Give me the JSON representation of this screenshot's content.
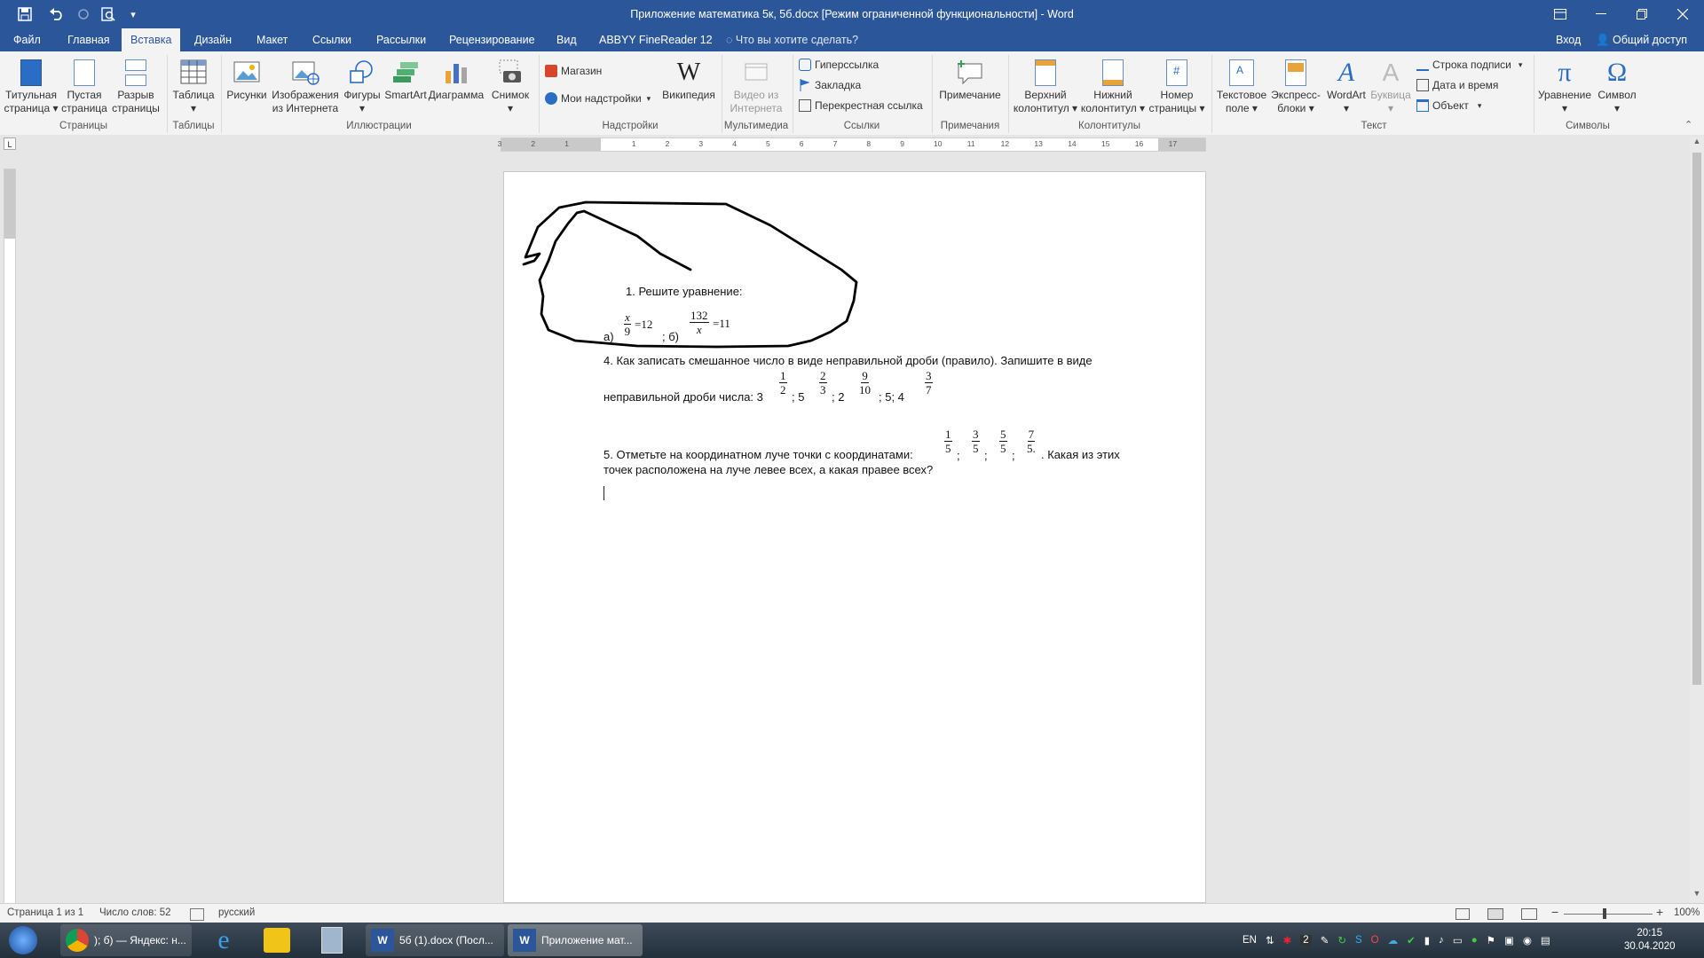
{
  "title_bar": {
    "document_title": "Приложение математика 5к, 5б.docx [Режим ограниченной функциональности] - Word"
  },
  "tabs": [
    "Файл",
    "Главная",
    "Вставка",
    "Дизайн",
    "Макет",
    "Ссылки",
    "Рассылки",
    "Рецензирование",
    "Вид",
    "ABBYY FineReader 12"
  ],
  "active_tab": "Вставка",
  "tell_me": "Что вы хотите сделать?",
  "sign_in": "Вход",
  "share": "Общий доступ",
  "ribbon": {
    "pages": {
      "group": "Страницы",
      "title_page": [
        "Титульная",
        "страница ▾"
      ],
      "blank_page": [
        "Пустая",
        "страница"
      ],
      "page_break": [
        "Разрыв",
        "страницы"
      ]
    },
    "tables": {
      "group": "Таблицы",
      "table": [
        "Таблица",
        "▾"
      ]
    },
    "illustrations": {
      "group": "Иллюстрации",
      "pictures": "Рисунки",
      "online_pictures": [
        "Изображения",
        "из Интернета"
      ],
      "shapes": [
        "Фигуры",
        "▾"
      ],
      "smartart": "SmartArt",
      "chart": "Диаграмма",
      "screenshot": [
        "Снимок",
        "▾"
      ]
    },
    "addins": {
      "group": "Надстройки",
      "store": "Магазин",
      "my_addins": "Мои надстройки",
      "wikipedia": "Википедия"
    },
    "media": {
      "group": "Мультимедиа",
      "online_video": [
        "Видео из",
        "Интернета"
      ]
    },
    "links": {
      "group": "Ссылки",
      "hyperlink": "Гиперссылка",
      "bookmark": "Закладка",
      "cross_reference": "Перекрестная ссылка"
    },
    "comments": {
      "group": "Примечания",
      "comment": "Примечание"
    },
    "header_footer": {
      "group": "Колонтитулы",
      "header": [
        "Верхний",
        "колонтитул ▾"
      ],
      "footer": [
        "Нижний",
        "колонтитул ▾"
      ],
      "page_number": [
        "Номер",
        "страницы ▾"
      ]
    },
    "text": {
      "group": "Текст",
      "text_box": [
        "Текстовое",
        "поле ▾"
      ],
      "quick_parts": [
        "Экспресс-",
        "блоки ▾"
      ],
      "wordart": [
        "WordArt",
        "▾"
      ],
      "drop_cap": [
        "Буквица",
        "▾"
      ],
      "signature_line": "Строка подписи",
      "date_time": "Дата и время",
      "object": "Объект"
    },
    "symbols": {
      "group": "Символы",
      "equation": [
        "Уравнение",
        "▾"
      ],
      "symbol": [
        "Символ",
        "▾"
      ]
    }
  },
  "ruler_numbers": [
    "3",
    "2",
    "1",
    "1",
    "2",
    "3",
    "4",
    "5",
    "6",
    "7",
    "8",
    "9",
    "10",
    "11",
    "12",
    "13",
    "14",
    "15",
    "16",
    "17"
  ],
  "document": {
    "q1": "1.   Решите уравнение:",
    "q1_a": "а)",
    "q1_eq1": {
      "num": "x",
      "den": "9",
      "rhs": "=12"
    },
    "q1_sep": "; б)",
    "q1_eq2": {
      "num": "132",
      "den": "x",
      "rhs": "=11"
    },
    "q4_line1": "4. Как записать смешанное число в виде неправильной дроби (правило). Запишите в виде",
    "q4_line2_prefix": "неправильной дроби числа: 3",
    "q4_fracs": [
      {
        "num": "1",
        "den": "2",
        "after": "; 5"
      },
      {
        "num": "2",
        "den": "3",
        "after": "; 2"
      },
      {
        "num": "9",
        "den": "10",
        "after": "; 5; 4"
      },
      {
        "num": "3",
        "den": "7",
        "after": ""
      }
    ],
    "q5_prefix": "5. Отметьте на координатном луче точки с координатами:",
    "q5_fracs": [
      {
        "num": "1",
        "den": "5",
        "after": ";"
      },
      {
        "num": "3",
        "den": "5",
        "after": ";"
      },
      {
        "num": "5",
        "den": "5",
        "after": ";"
      },
      {
        "num": "7",
        "den": "5.",
        "after": ""
      }
    ],
    "q5_suffix": ". Какая из этих",
    "q5_line2": "точек расположена на луче левее всех, а какая правее всех?"
  },
  "status": {
    "page": "Страница 1 из 1",
    "words": "Число слов: 52",
    "language": "русский",
    "zoom": "100%"
  },
  "taskbar": {
    "items": [
      {
        "label": "); б) — Яндекс: н..."
      },
      {
        "label": "5б (1).docx (Посл..."
      },
      {
        "label": "Приложение мат..."
      }
    ],
    "lang": "EN",
    "tray_number": "2",
    "time": "20:15",
    "date": "30.04.2020"
  },
  "colors": {
    "word_blue": "#2b579a",
    "ribbon_bg": "#f3f3f3",
    "canvas": "#e6e6e6"
  }
}
